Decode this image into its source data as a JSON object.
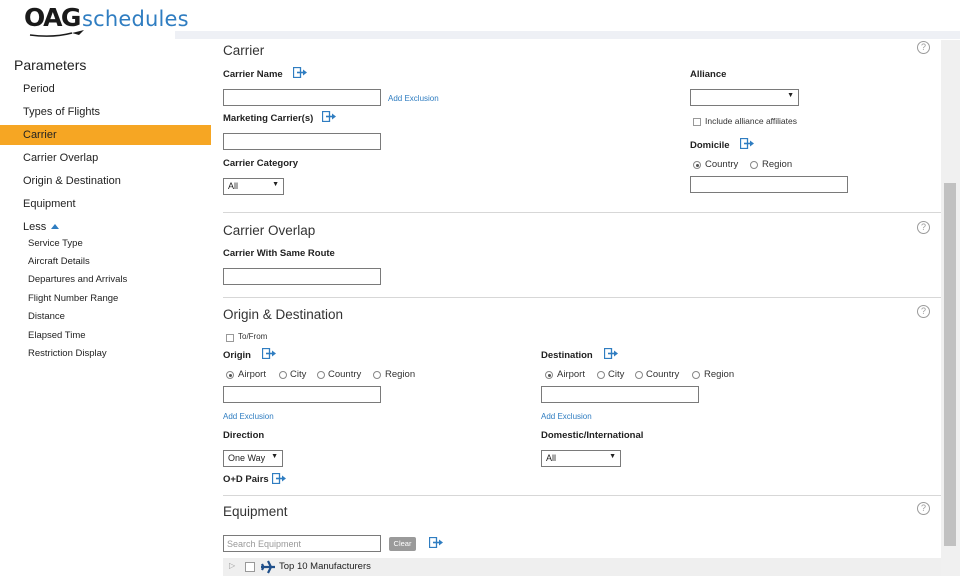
{
  "header": {
    "logo_part1": "OAG",
    "logo_part2": "schedules"
  },
  "sidebar": {
    "title": "Parameters",
    "items": [
      {
        "label": "Period"
      },
      {
        "label": "Types of Flights"
      },
      {
        "label": "Carrier",
        "active": true
      },
      {
        "label": "Carrier Overlap"
      },
      {
        "label": "Origin & Destination"
      },
      {
        "label": "Equipment"
      },
      {
        "label": "Less"
      }
    ],
    "sub_items": [
      {
        "label": "Service Type"
      },
      {
        "label": "Aircraft Details"
      },
      {
        "label": "Departures and Arrivals"
      },
      {
        "label": "Flight Number Range"
      },
      {
        "label": "Distance"
      },
      {
        "label": "Elapsed Time"
      },
      {
        "label": "Restriction Display"
      }
    ]
  },
  "carrier": {
    "title": "Carrier",
    "carrier_name_label": "Carrier Name",
    "carrier_name_value": "",
    "add_exclusion": "Add Exclusion",
    "marketing_label": "Marketing Carrier(s)",
    "marketing_value": "",
    "category_label": "Carrier Category",
    "category_value": "All",
    "alliance_label": "Alliance",
    "alliance_value": "",
    "include_affiliates": "Include alliance affiliates",
    "domicile_label": "Domicile",
    "domicile_options": [
      "Country",
      "Region"
    ],
    "domicile_value": ""
  },
  "overlap": {
    "title": "Carrier Overlap",
    "same_route_label": "Carrier With Same Route",
    "same_route_value": ""
  },
  "od": {
    "title": "Origin & Destination",
    "to_from": "To/From",
    "origin_label": "Origin",
    "destination_label": "Destination",
    "location_options": [
      "Airport",
      "City",
      "Country",
      "Region"
    ],
    "origin_value": "",
    "destination_value": "",
    "add_exclusion": "Add Exclusion",
    "direction_label": "Direction",
    "direction_value": "One Way",
    "domint_label": "Domestic/International",
    "domint_value": "All",
    "od_pairs": "O+D Pairs"
  },
  "equipment": {
    "title": "Equipment",
    "search_placeholder": "Search Equipment",
    "clear": "Clear",
    "top_manufacturers": "Top 10 Manufacturers"
  },
  "colors": {
    "accent": "#f6a623",
    "link": "#2f7dc1"
  }
}
